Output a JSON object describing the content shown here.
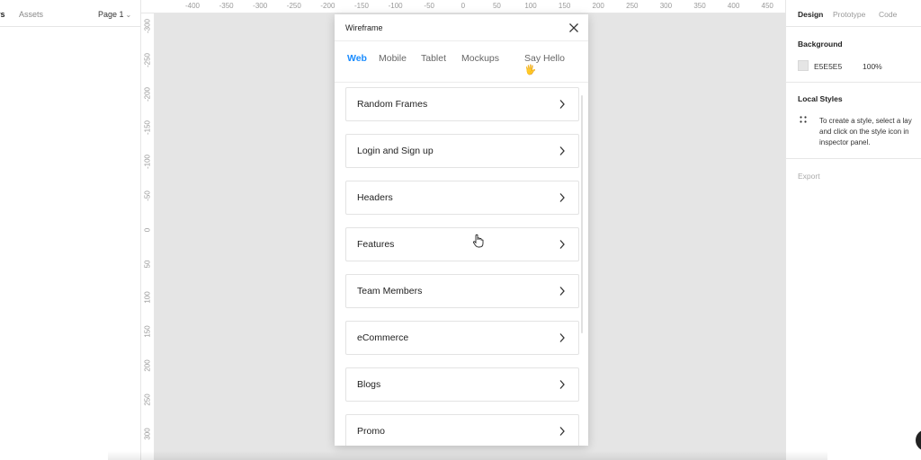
{
  "left_panel": {
    "tab_layers": "rs",
    "tab_assets": "Assets",
    "page_select": "Page 1"
  },
  "top_ruler": [
    "-400",
    "-350",
    "-300",
    "-250",
    "-200",
    "-150",
    "-100",
    "-50",
    "0",
    "50",
    "100",
    "150",
    "200",
    "250",
    "300",
    "350",
    "400",
    "450"
  ],
  "left_ruler": [
    "-300",
    "-250",
    "-200",
    "-150",
    "-100",
    "-50",
    "0",
    "50",
    "100",
    "150",
    "200",
    "250",
    "300"
  ],
  "plugin": {
    "title": "Wireframe",
    "tabs": [
      "Web",
      "Mobile",
      "Tablet",
      "Mockups",
      "Say Hello 🖐"
    ],
    "active_tab": "Web",
    "items": [
      "Random Frames",
      "Login and Sign up",
      "Headers",
      "Features",
      "Team Members",
      "eCommerce",
      "Blogs",
      "Promo"
    ]
  },
  "right_panel": {
    "tabs": [
      "Design",
      "Prototype",
      "Code"
    ],
    "background_title": "Background",
    "background_hex": "E5E5E5",
    "background_opacity": "100%",
    "local_styles_title": "Local Styles",
    "local_styles_text": "To create a style, select a lay\nand click on the style icon in\ninspector panel.",
    "export_label": "Export"
  },
  "colors": {
    "accent": "#1a8cff",
    "canvas": "#e5e5e5"
  }
}
